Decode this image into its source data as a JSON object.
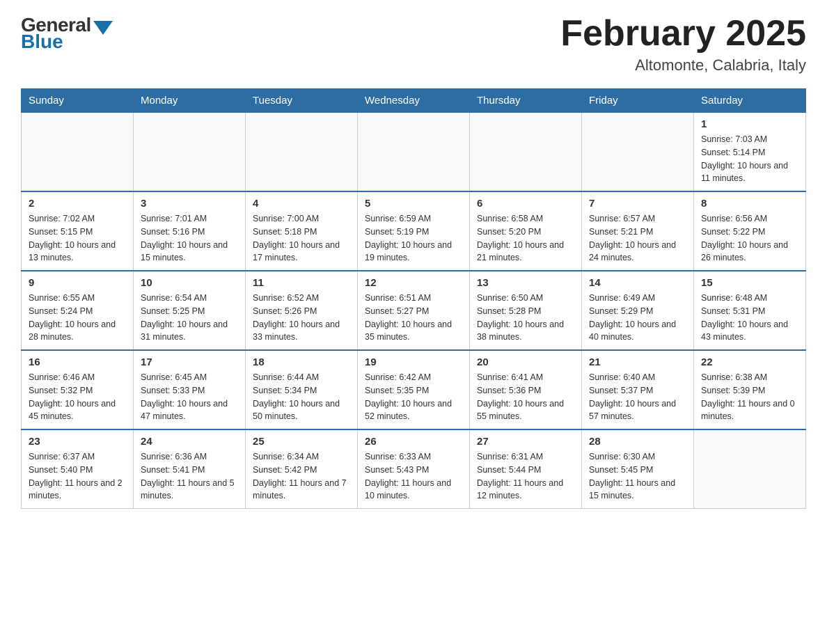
{
  "header": {
    "logo_general": "General",
    "logo_blue": "Blue",
    "month_title": "February 2025",
    "location": "Altomonte, Calabria, Italy"
  },
  "days_of_week": [
    "Sunday",
    "Monday",
    "Tuesday",
    "Wednesday",
    "Thursday",
    "Friday",
    "Saturday"
  ],
  "weeks": [
    [
      {
        "day": "",
        "info": ""
      },
      {
        "day": "",
        "info": ""
      },
      {
        "day": "",
        "info": ""
      },
      {
        "day": "",
        "info": ""
      },
      {
        "day": "",
        "info": ""
      },
      {
        "day": "",
        "info": ""
      },
      {
        "day": "1",
        "info": "Sunrise: 7:03 AM\nSunset: 5:14 PM\nDaylight: 10 hours and 11 minutes."
      }
    ],
    [
      {
        "day": "2",
        "info": "Sunrise: 7:02 AM\nSunset: 5:15 PM\nDaylight: 10 hours and 13 minutes."
      },
      {
        "day": "3",
        "info": "Sunrise: 7:01 AM\nSunset: 5:16 PM\nDaylight: 10 hours and 15 minutes."
      },
      {
        "day": "4",
        "info": "Sunrise: 7:00 AM\nSunset: 5:18 PM\nDaylight: 10 hours and 17 minutes."
      },
      {
        "day": "5",
        "info": "Sunrise: 6:59 AM\nSunset: 5:19 PM\nDaylight: 10 hours and 19 minutes."
      },
      {
        "day": "6",
        "info": "Sunrise: 6:58 AM\nSunset: 5:20 PM\nDaylight: 10 hours and 21 minutes."
      },
      {
        "day": "7",
        "info": "Sunrise: 6:57 AM\nSunset: 5:21 PM\nDaylight: 10 hours and 24 minutes."
      },
      {
        "day": "8",
        "info": "Sunrise: 6:56 AM\nSunset: 5:22 PM\nDaylight: 10 hours and 26 minutes."
      }
    ],
    [
      {
        "day": "9",
        "info": "Sunrise: 6:55 AM\nSunset: 5:24 PM\nDaylight: 10 hours and 28 minutes."
      },
      {
        "day": "10",
        "info": "Sunrise: 6:54 AM\nSunset: 5:25 PM\nDaylight: 10 hours and 31 minutes."
      },
      {
        "day": "11",
        "info": "Sunrise: 6:52 AM\nSunset: 5:26 PM\nDaylight: 10 hours and 33 minutes."
      },
      {
        "day": "12",
        "info": "Sunrise: 6:51 AM\nSunset: 5:27 PM\nDaylight: 10 hours and 35 minutes."
      },
      {
        "day": "13",
        "info": "Sunrise: 6:50 AM\nSunset: 5:28 PM\nDaylight: 10 hours and 38 minutes."
      },
      {
        "day": "14",
        "info": "Sunrise: 6:49 AM\nSunset: 5:29 PM\nDaylight: 10 hours and 40 minutes."
      },
      {
        "day": "15",
        "info": "Sunrise: 6:48 AM\nSunset: 5:31 PM\nDaylight: 10 hours and 43 minutes."
      }
    ],
    [
      {
        "day": "16",
        "info": "Sunrise: 6:46 AM\nSunset: 5:32 PM\nDaylight: 10 hours and 45 minutes."
      },
      {
        "day": "17",
        "info": "Sunrise: 6:45 AM\nSunset: 5:33 PM\nDaylight: 10 hours and 47 minutes."
      },
      {
        "day": "18",
        "info": "Sunrise: 6:44 AM\nSunset: 5:34 PM\nDaylight: 10 hours and 50 minutes."
      },
      {
        "day": "19",
        "info": "Sunrise: 6:42 AM\nSunset: 5:35 PM\nDaylight: 10 hours and 52 minutes."
      },
      {
        "day": "20",
        "info": "Sunrise: 6:41 AM\nSunset: 5:36 PM\nDaylight: 10 hours and 55 minutes."
      },
      {
        "day": "21",
        "info": "Sunrise: 6:40 AM\nSunset: 5:37 PM\nDaylight: 10 hours and 57 minutes."
      },
      {
        "day": "22",
        "info": "Sunrise: 6:38 AM\nSunset: 5:39 PM\nDaylight: 11 hours and 0 minutes."
      }
    ],
    [
      {
        "day": "23",
        "info": "Sunrise: 6:37 AM\nSunset: 5:40 PM\nDaylight: 11 hours and 2 minutes."
      },
      {
        "day": "24",
        "info": "Sunrise: 6:36 AM\nSunset: 5:41 PM\nDaylight: 11 hours and 5 minutes."
      },
      {
        "day": "25",
        "info": "Sunrise: 6:34 AM\nSunset: 5:42 PM\nDaylight: 11 hours and 7 minutes."
      },
      {
        "day": "26",
        "info": "Sunrise: 6:33 AM\nSunset: 5:43 PM\nDaylight: 11 hours and 10 minutes."
      },
      {
        "day": "27",
        "info": "Sunrise: 6:31 AM\nSunset: 5:44 PM\nDaylight: 11 hours and 12 minutes."
      },
      {
        "day": "28",
        "info": "Sunrise: 6:30 AM\nSunset: 5:45 PM\nDaylight: 11 hours and 15 minutes."
      },
      {
        "day": "",
        "info": ""
      }
    ]
  ]
}
